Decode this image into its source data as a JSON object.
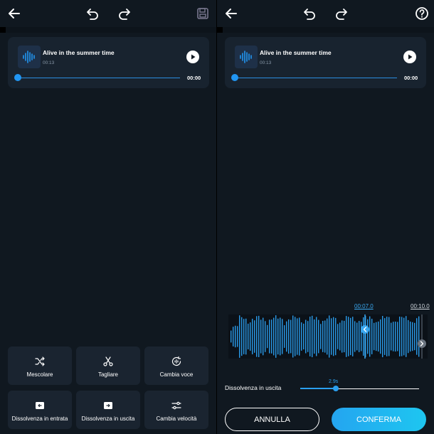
{
  "left": {
    "track": {
      "title": "Alive in the summer time",
      "duration": "00:13",
      "position": "00:00",
      "progress": 0
    },
    "tools": [
      {
        "label": "Mescolare",
        "icon": "shuffle-icon"
      },
      {
        "label": "Tagliare",
        "icon": "scissors-icon"
      },
      {
        "label": "Cambia voce",
        "icon": "voice-change-icon"
      },
      {
        "label": "Dissolvenza in entrata",
        "icon": "fade-in-icon"
      },
      {
        "label": "Dissolvenza in uscita",
        "icon": "fade-out-icon"
      },
      {
        "label": "Cambia velocità",
        "icon": "speed-icon"
      }
    ]
  },
  "right": {
    "track": {
      "title": "Alive in the summer time",
      "duration": "00:13",
      "position": "00:00",
      "progress": 0
    },
    "timeline": {
      "current": "00:07.0",
      "end": "00:10.0"
    },
    "fade_out": {
      "label": "Dissolvenza in uscita",
      "value": "2.9s",
      "fraction": 0.3
    },
    "buttons": {
      "cancel": "ANNULLA",
      "confirm": "CONFERMA"
    }
  },
  "colors": {
    "background": "#101820",
    "card": "#18232f",
    "accent": "#2196f3",
    "confirm_start": "#24a5f0",
    "confirm_end": "#1ec6f0"
  }
}
